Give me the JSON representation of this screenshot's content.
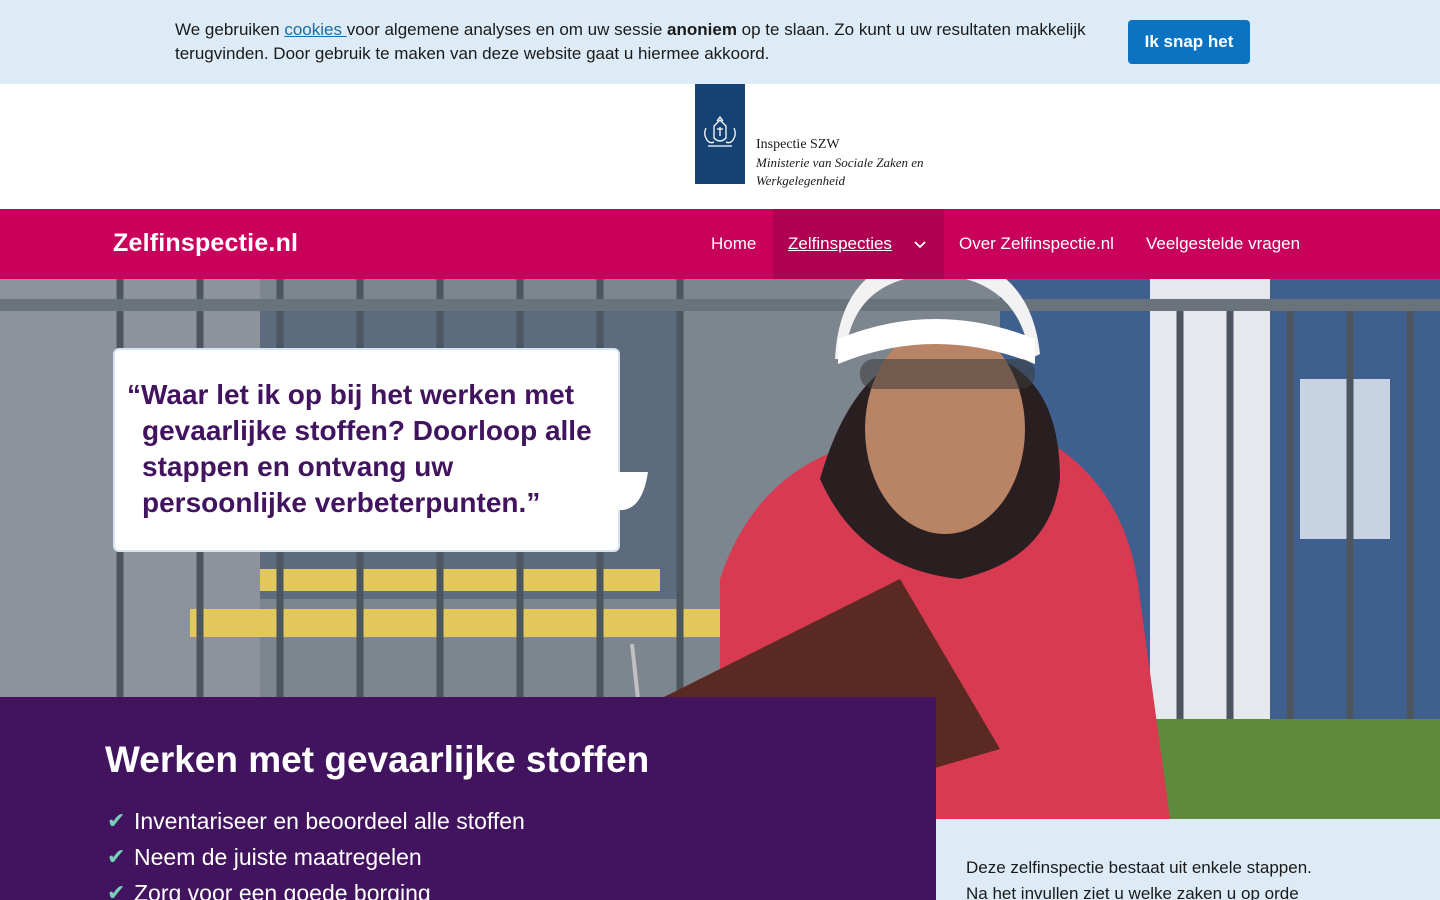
{
  "cookie": {
    "text_before": "We gebruiken ",
    "link": "cookies ",
    "text_middle": "voor algemene analyses en om uw sessie ",
    "bold": "anoniem",
    "text_after": " op te slaan. Zo kunt u uw resultaten makkelijk terugvinden. Door gebruik te maken van deze website gaat u hiermee akkoord.",
    "button": "Ik snap het"
  },
  "logo": {
    "title": "Inspectie SZW",
    "subtitle_line1": "Ministerie van Sociale Zaken en",
    "subtitle_line2": "Werkgelegenheid"
  },
  "nav": {
    "brand": "Zelfinspectie.nl",
    "items": [
      {
        "label": "Home"
      },
      {
        "label": "Zelfinspecties"
      },
      {
        "label": "Over Zelfinspectie.nl"
      },
      {
        "label": "Veelgestelde vragen"
      }
    ]
  },
  "hero": {
    "quote": "“Waar let ik op bij het werken met gevaarlijke stoffen? Doorloop alle stappen en ontvang uw persoonlijke verbeterpunten.”"
  },
  "panel": {
    "title": "Werken met gevaarlijke stoffen",
    "items": [
      "Inventariseer en beoordeel alle stoffen",
      "Neem de juiste maatregelen",
      "Zorg voor een goede borging"
    ]
  },
  "info": {
    "line1": "Deze zelfinspectie bestaat uit enkele stappen.",
    "line2": "Na het invullen ziet u welke zaken u op orde"
  },
  "colors": {
    "nav": "#ca005d",
    "purple": "#42145f",
    "cookie_bg": "#ddebf6",
    "button": "#0b73c2",
    "check": "#76d2b6"
  },
  "icons": [
    "coat-of-arms-icon",
    "chevron-down-icon",
    "check-icon"
  ]
}
